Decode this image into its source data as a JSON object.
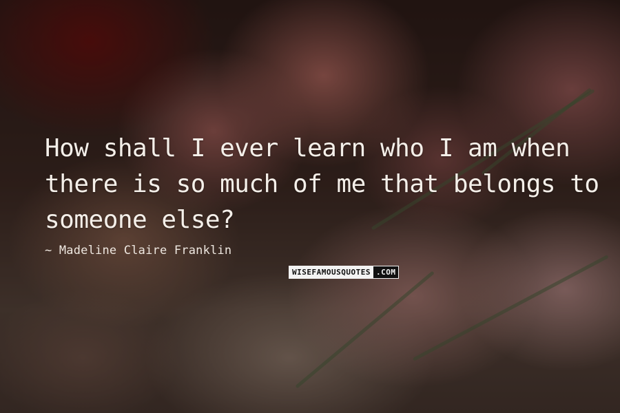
{
  "quote": {
    "text": "How shall I ever learn who I am when there is so much of me that belongs to someone else?"
  },
  "author": {
    "text": "~ Madeline Claire Franklin"
  },
  "watermark": {
    "part1": "WISEFAMOUSQUOTES",
    "part2": ".COM"
  },
  "colors": {
    "text": "#f4efe9",
    "background_dark": "#2b1a17",
    "petal_pink": "#e1a09b",
    "deep_red": "#780a0a"
  }
}
